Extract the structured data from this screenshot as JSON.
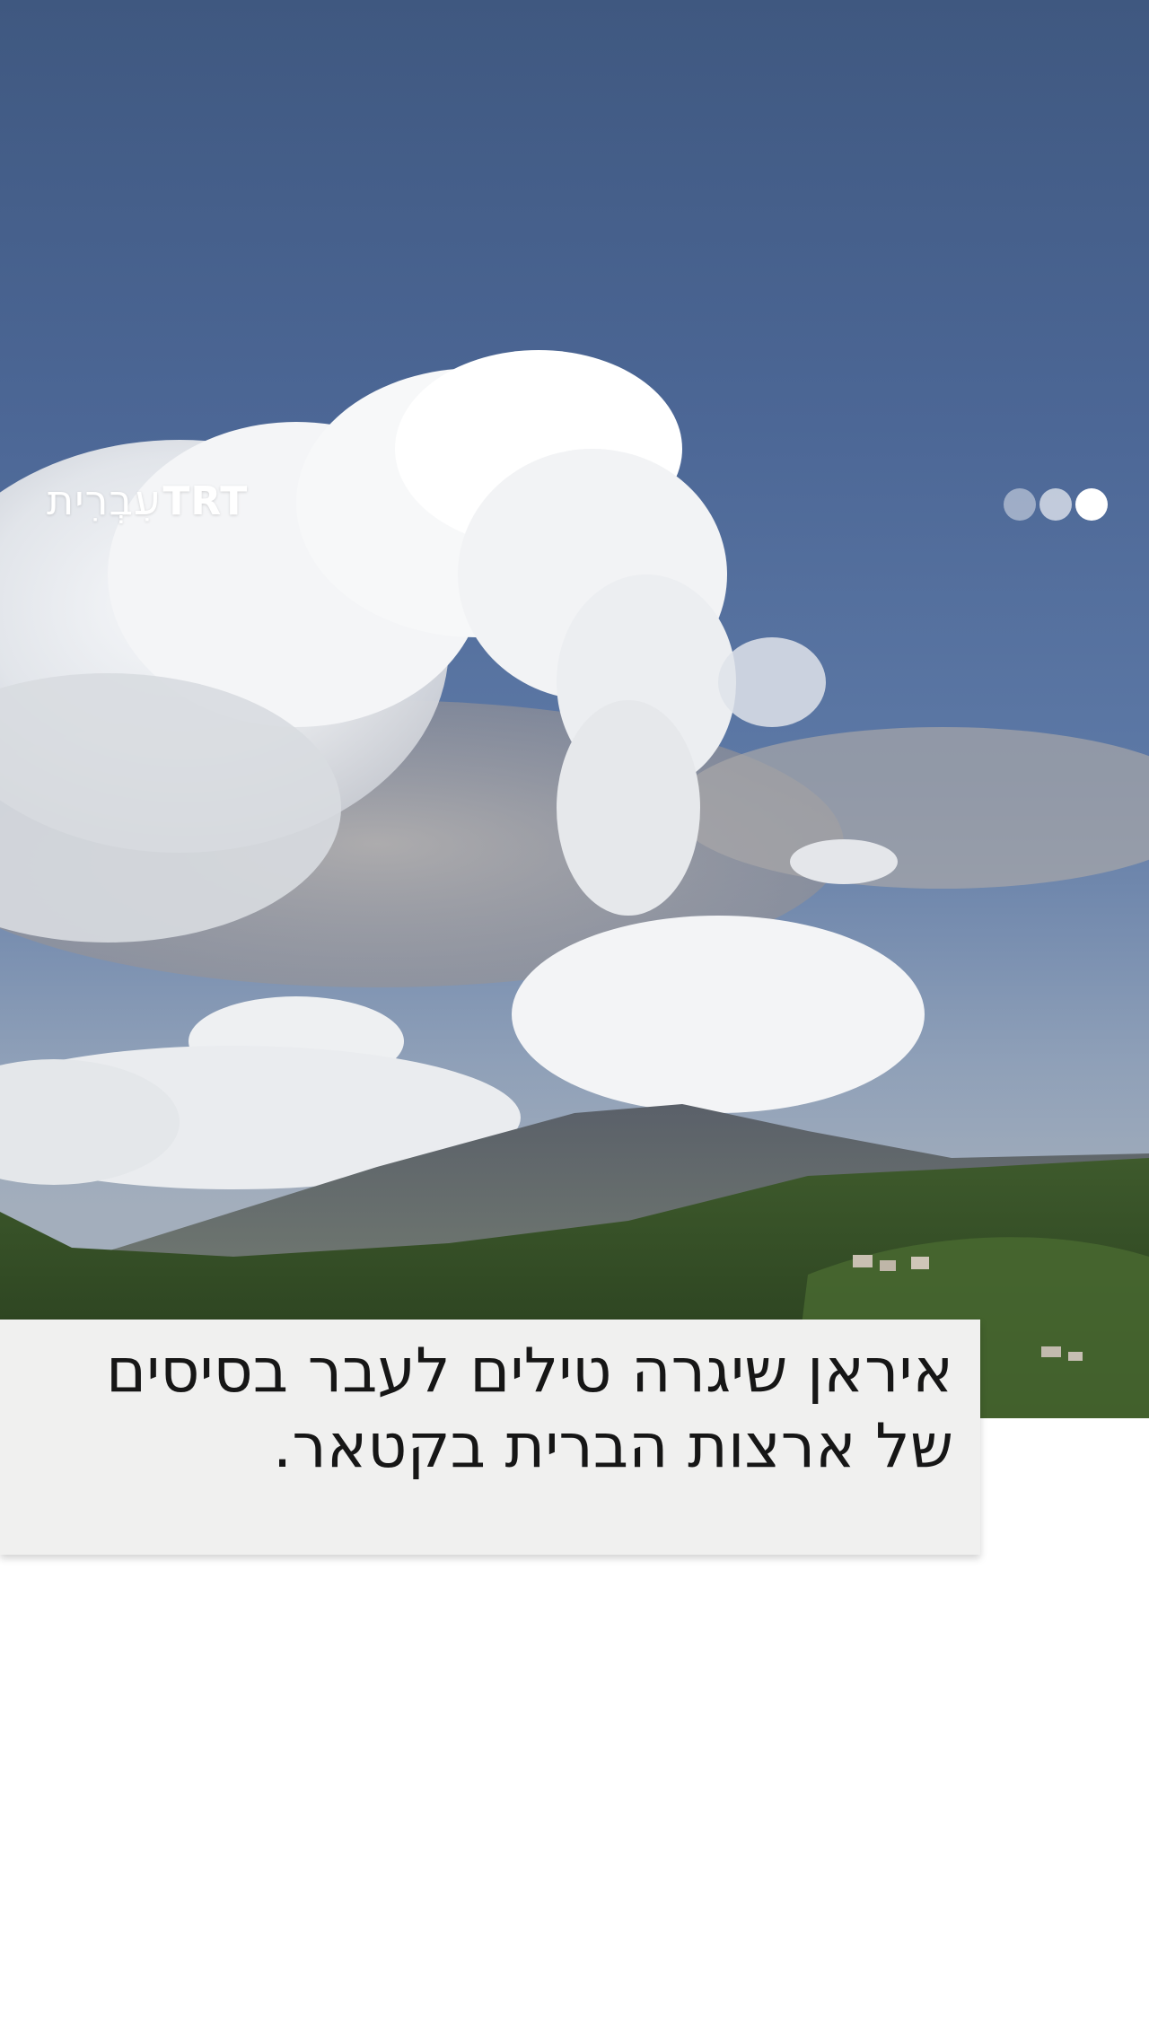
{
  "brand": {
    "latin": "TRT",
    "hebrew": "עִבְרִית"
  },
  "pager": {
    "total": 3,
    "active_index": 0
  },
  "caption": {
    "text": "איראן שיגרה טילים לעבר בסיסים של ארצות הברית בקטאר."
  },
  "colors": {
    "caption_background": "#f0f0ef",
    "caption_text": "#161616",
    "brand_text": "#ffffff"
  }
}
